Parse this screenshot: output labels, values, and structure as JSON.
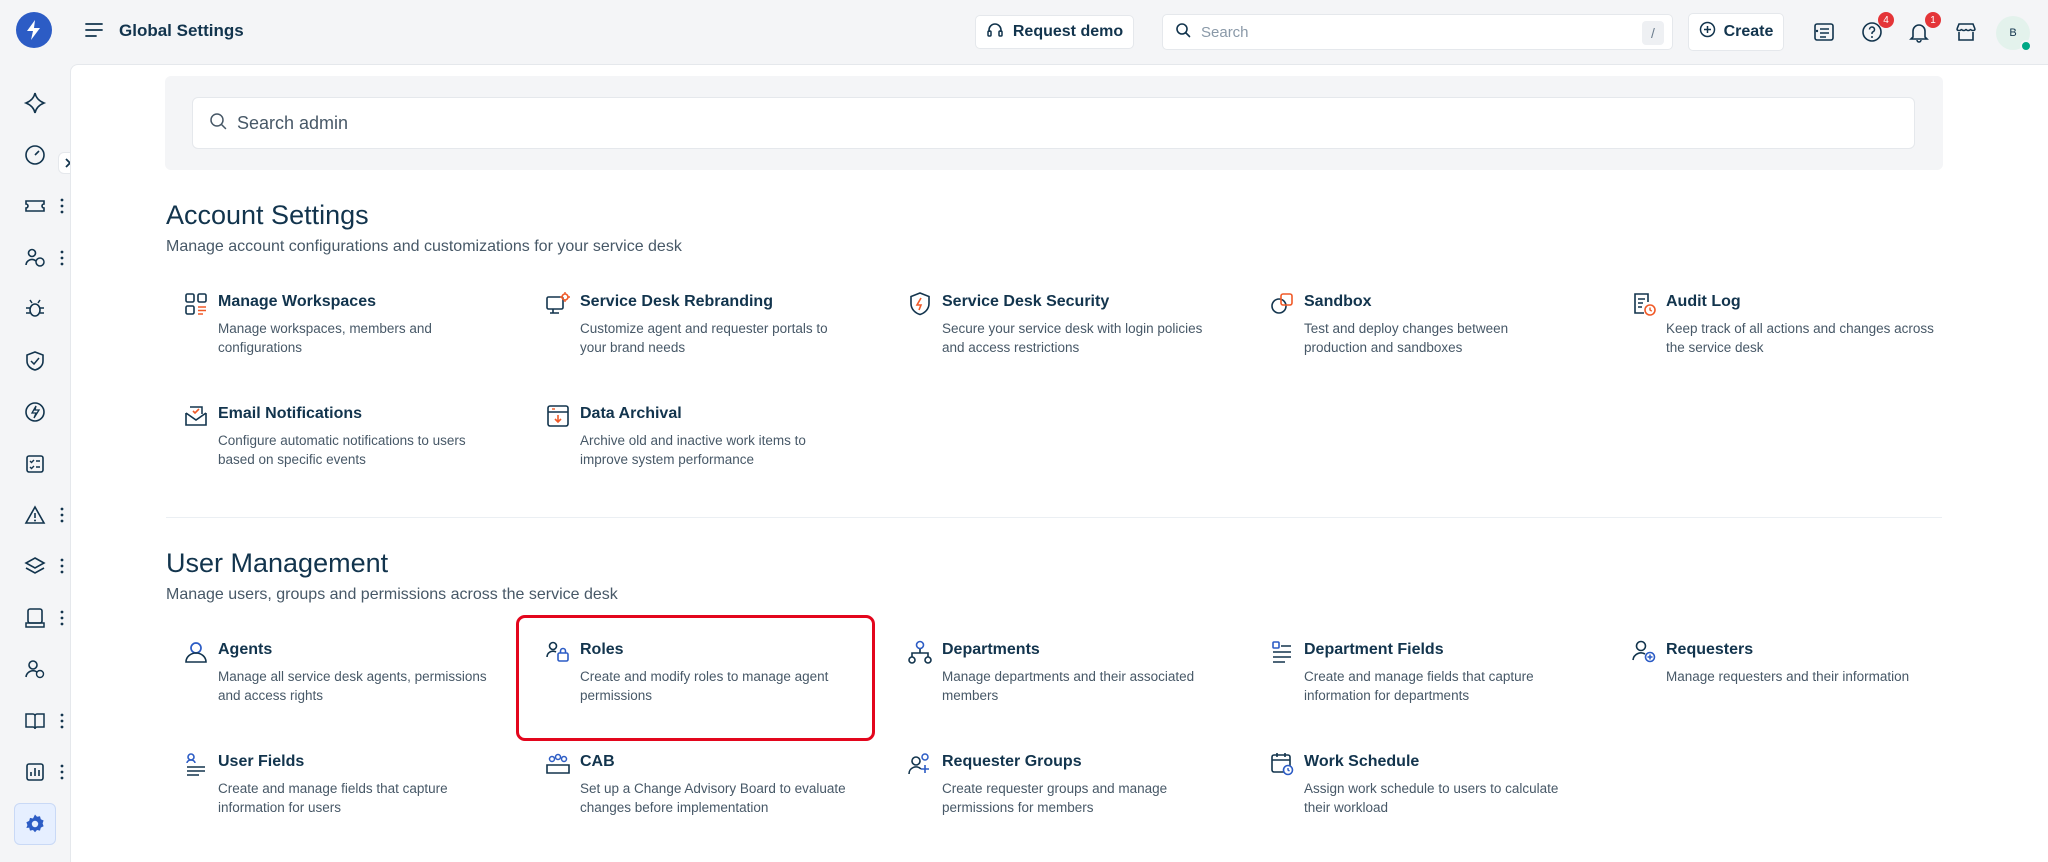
{
  "header": {
    "title": "Global Settings",
    "request_demo": "Request demo",
    "search_placeholder": "Search",
    "search_shortcut": "/",
    "create_label": "Create",
    "help_badge": "4",
    "notifications_badge": "1",
    "avatar_initial": "B"
  },
  "admin_search": {
    "placeholder": "Search admin"
  },
  "account_settings": {
    "title": "Account Settings",
    "subtitle": "Manage account configurations and customizations for your service desk",
    "cards": [
      {
        "title": "Manage Workspaces",
        "desc": "Manage workspaces, members and configurations",
        "icon": "workspaces-icon"
      },
      {
        "title": "Service Desk Rebranding",
        "desc": "Customize agent and requester portals to your brand needs",
        "icon": "rebranding-icon"
      },
      {
        "title": "Service Desk Security",
        "desc": "Secure your service desk with login policies and access restrictions",
        "icon": "security-shield-icon"
      },
      {
        "title": "Sandbox",
        "desc": "Test and deploy changes between production and sandboxes",
        "icon": "sandbox-icon"
      },
      {
        "title": "Audit Log",
        "desc": "Keep track of all actions and changes across the service desk",
        "icon": "audit-log-icon"
      },
      {
        "title": "Email Notifications",
        "desc": "Configure automatic notifications to users based on specific events",
        "icon": "email-notifications-icon"
      },
      {
        "title": "Data Archival",
        "desc": "Archive old and inactive work items to improve system performance",
        "icon": "data-archival-icon"
      }
    ]
  },
  "user_management": {
    "title": "User Management",
    "subtitle": "Manage users, groups and permissions across the service desk",
    "cards": [
      {
        "title": "Agents",
        "desc": "Manage all service desk agents, permissions and access rights",
        "icon": "agents-icon"
      },
      {
        "title": "Roles",
        "desc": "Create and modify roles to manage agent permissions",
        "icon": "roles-icon"
      },
      {
        "title": "Departments",
        "desc": "Manage departments and their associated members",
        "icon": "departments-icon"
      },
      {
        "title": "Department Fields",
        "desc": "Create and manage fields that capture information for departments",
        "icon": "department-fields-icon"
      },
      {
        "title": "Requesters",
        "desc": "Manage requesters and their information",
        "icon": "requesters-icon"
      },
      {
        "title": "User Fields",
        "desc": "Create and manage fields that capture information for users",
        "icon": "user-fields-icon"
      },
      {
        "title": "CAB",
        "desc": "Set up a Change Advisory Board to evaluate changes before implementation",
        "icon": "cab-icon"
      },
      {
        "title": "Requester Groups",
        "desc": "Create requester groups and manage permissions for members",
        "icon": "requester-groups-icon"
      },
      {
        "title": "Work Schedule",
        "desc": "Assign work schedule to users to calculate their workload",
        "icon": "work-schedule-icon"
      }
    ]
  },
  "colors": {
    "brand": "#2c5cc5",
    "accent_orange": "#f05a28",
    "text": "#12344d",
    "highlight": "#e3061d"
  }
}
